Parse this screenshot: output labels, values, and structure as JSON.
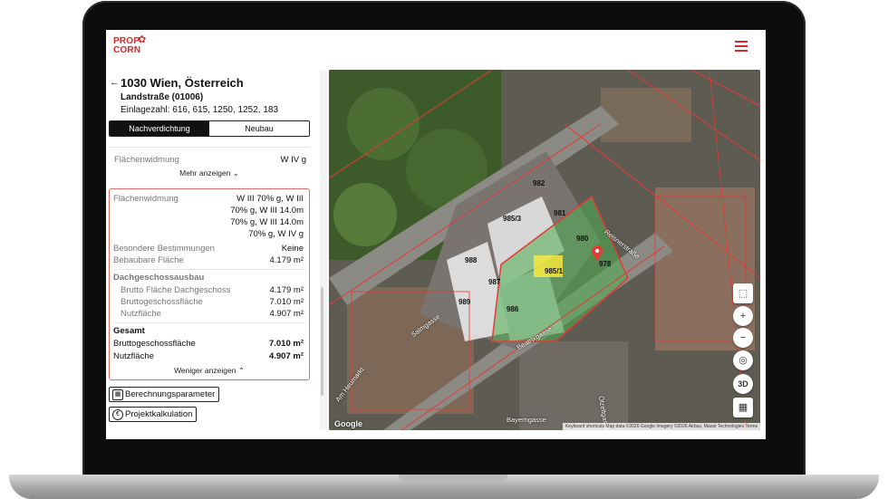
{
  "brand": {
    "logo_line1": "PROP",
    "logo_line2": "CORN",
    "accent": "#d62828"
  },
  "header": {
    "menu_icon": "hamburger-menu-icon"
  },
  "address": {
    "title": "1030 Wien, Österreich",
    "district": "Landstraße (01006)",
    "einlagezahl": "Einlagezahl: 616, 615, 1250, 1252, 183"
  },
  "tabs": [
    {
      "label": "Nachverdichtung",
      "active": true
    },
    {
      "label": "Neubau",
      "active": false
    }
  ],
  "summary": {
    "flaechenwidmung_label": "Flächenwidmung",
    "flaechenwidmung_value": "W IV g",
    "more_link": "Mehr anzeigen"
  },
  "detail": {
    "flaechenwidmung_label": "Flächenwidmung",
    "flaechenwidmung_lines": [
      "W III 70% g, W III",
      "70% g, W III 14.0m",
      "70% g, W III 14.0m",
      "70% g, W IV g"
    ],
    "besondere_label": "Besondere Bestimmungen",
    "besondere_value": "Keine",
    "bebaubare_label": "Bebaubare Fläche",
    "bebaubare_value": "4.179 m²",
    "dg_section": "Dachgeschossausbau",
    "dg_rows": [
      {
        "label": "Brutto Fläche Dachgeschoss",
        "value": "4.179 m²"
      },
      {
        "label": "Bruttogeschossfläche",
        "value": "7.010 m²"
      },
      {
        "label": "Nutzfläche",
        "value": "4.907 m²"
      }
    ],
    "gesamt_section": "Gesamt",
    "gesamt_rows": [
      {
        "label": "Bruttogeschossfläche",
        "value": "7.010 m²"
      },
      {
        "label": "Nutzfläche",
        "value": "4.907 m²"
      }
    ],
    "less_link": "Weniger anzeigen"
  },
  "actions": {
    "params_label": "Berechnungsparameter",
    "kalk_label": "Projektkalkulation"
  },
  "map": {
    "plots": [
      "982",
      "981",
      "985/3",
      "980",
      "978",
      "988",
      "985/1",
      "987",
      "989",
      "986"
    ],
    "streets": [
      "Salmgasse",
      "Reisnerstraße",
      "Beatrixgasse",
      "Bayerngasse",
      "Am Heumarkt",
      "Ölzeltgasse"
    ],
    "controls": [
      "select-icon",
      "zoom-in-icon",
      "zoom-out-icon",
      "locate-icon",
      "3D",
      "layers-icon"
    ],
    "attribution": "Keyboard shortcuts   Map data ©2026 Google Imagery ©2026 Airbus, Maxar Technologies   Terms",
    "google_label": "Google"
  }
}
